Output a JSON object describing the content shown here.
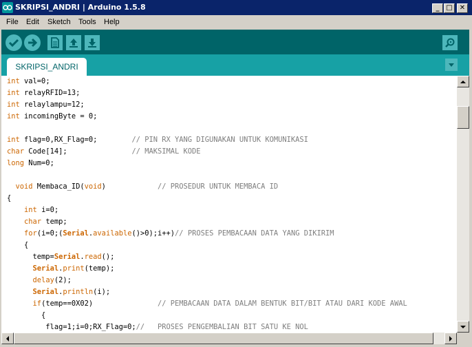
{
  "window": {
    "title": "SKRIPSI_ANDRI | Arduino 1.5.8",
    "buttons": {
      "minimize": "_",
      "maximize": "□",
      "close": "✕"
    }
  },
  "menu": [
    "File",
    "Edit",
    "Sketch",
    "Tools",
    "Help"
  ],
  "toolbar": {
    "buttons": [
      "verify-icon",
      "upload-icon",
      "new-file-icon",
      "open-icon",
      "save-icon"
    ],
    "serial_monitor": "serial-monitor-icon"
  },
  "tabs": [
    {
      "label": "SKRIPSI_ANDRI",
      "active": true
    }
  ],
  "colors": {
    "keyword": "#cc6600",
    "serial": "#cc6600",
    "comment": "#7e7e7e",
    "toolbar": "#006468",
    "tabbar": "#17a1a5",
    "button": "#4db7bb",
    "titlebar": "#0a246a"
  },
  "code_lines": [
    [
      [
        "k",
        "int"
      ],
      [
        "t",
        " val=0;"
      ]
    ],
    [
      [
        "k",
        "int"
      ],
      [
        "t",
        " relayRFID=13;"
      ]
    ],
    [
      [
        "k",
        "int"
      ],
      [
        "t",
        " relaylampu=12;"
      ]
    ],
    [
      [
        "k",
        "int"
      ],
      [
        "t",
        " incomingByte = 0;"
      ]
    ],
    [],
    [
      [
        "k",
        "int"
      ],
      [
        "t",
        " flag=0,RX_Flag=0;        "
      ],
      [
        "c",
        "// PIN RX YANG DIGUNAKAN UNTUK KOMUNIKASI"
      ]
    ],
    [
      [
        "k",
        "char"
      ],
      [
        "t",
        " Code[14];               "
      ],
      [
        "c",
        "// MAKSIMAL KODE"
      ]
    ],
    [
      [
        "k",
        "long"
      ],
      [
        "t",
        " Num=0;"
      ]
    ],
    [],
    [
      [
        "t",
        "  "
      ],
      [
        "k",
        "void"
      ],
      [
        "t",
        " Membaca_ID("
      ],
      [
        "k",
        "void"
      ],
      [
        "t",
        ")            "
      ],
      [
        "c",
        "// PROSEDUR UNTUK MEMBACA ID"
      ]
    ],
    [
      [
        "t",
        "{"
      ]
    ],
    [
      [
        "t",
        "    "
      ],
      [
        "k",
        "int"
      ],
      [
        "t",
        " i=0;"
      ]
    ],
    [
      [
        "t",
        "    "
      ],
      [
        "k",
        "char"
      ],
      [
        "t",
        " temp;"
      ]
    ],
    [
      [
        "t",
        "    "
      ],
      [
        "k",
        "for"
      ],
      [
        "t",
        "(i=0;("
      ],
      [
        "s",
        "Serial"
      ],
      [
        "t",
        "."
      ],
      [
        "k",
        "available"
      ],
      [
        "t",
        "()>0);i++)"
      ],
      [
        "c",
        "// PROSES PEMBACAAN DATA YANG DIKIRIM"
      ]
    ],
    [
      [
        "t",
        "    {"
      ]
    ],
    [
      [
        "t",
        "      temp="
      ],
      [
        "s",
        "Serial"
      ],
      [
        "t",
        "."
      ],
      [
        "k",
        "read"
      ],
      [
        "t",
        "();"
      ]
    ],
    [
      [
        "t",
        "      "
      ],
      [
        "s",
        "Serial"
      ],
      [
        "t",
        "."
      ],
      [
        "k",
        "print"
      ],
      [
        "t",
        "(temp);"
      ]
    ],
    [
      [
        "t",
        "      "
      ],
      [
        "k",
        "delay"
      ],
      [
        "t",
        "(2);"
      ]
    ],
    [
      [
        "t",
        "      "
      ],
      [
        "s",
        "Serial"
      ],
      [
        "t",
        "."
      ],
      [
        "k",
        "println"
      ],
      [
        "t",
        "(i);"
      ]
    ],
    [
      [
        "t",
        "      "
      ],
      [
        "k",
        "if"
      ],
      [
        "t",
        "(temp==0X02)               "
      ],
      [
        "c",
        "// PEMBACAAN DATA DALAM BENTUK BIT/BIT ATAU DARI KODE AWAL"
      ]
    ],
    [
      [
        "t",
        "        {"
      ]
    ],
    [
      [
        "t",
        "         flag=1;i=0;RX_Flag=0;"
      ],
      [
        "c",
        "//   PROSES PENGEMBALIAN BIT SATU KE NOL"
      ]
    ]
  ]
}
